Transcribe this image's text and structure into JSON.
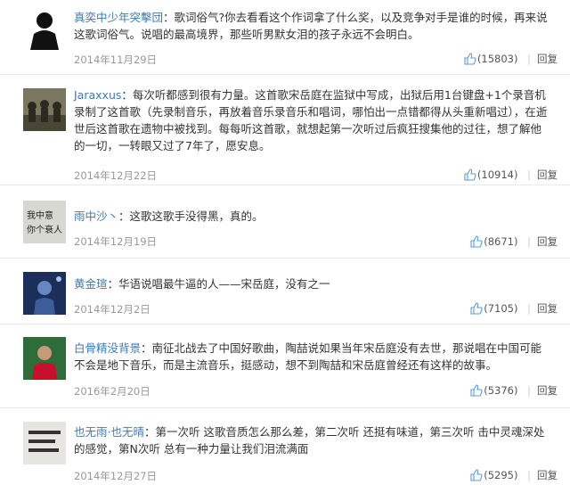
{
  "comments": [
    {
      "username": "真奕中少年突擊団",
      "text": "歌词俗气?你去看看这个作词拿了什么奖，以及竞争对手是谁的时候，再来说这歌词俗气。说唱的最高境界，那些听男默女泪的孩子永远不会明白。",
      "date": "2014年11月29日",
      "likes": "(15803)",
      "reply": "回复"
    },
    {
      "username": "Jaraxxus",
      "text": "每次听都感到很有力量。这首歌宋岳庭在监狱中写成，出狱后用1台键盘+1个录音机录制了这首歌（先录制音乐，再放着音乐录音乐和唱词，哪怕出一点错都得从头重新唱过），在逝世后这首歌在遗物中被找到。每每听这首歌，就想起第一次听过后疯狂搜集他的过往，想了解他的一切，一转眼又过了7年了，愿安息。",
      "date": "2014年12月22日",
      "likes": "(10914)",
      "reply": "回复"
    },
    {
      "username": "雨中沙丶",
      "text": "这歌这歌手没得黑，真的。",
      "date": "2014年12月19日",
      "likes": "(8671)",
      "reply": "回复"
    },
    {
      "username": "黄金瑄",
      "text": "华语说唱最牛逼的人——宋岳庭，没有之一",
      "date": "2014年12月2日",
      "likes": "(7105)",
      "reply": "回复"
    },
    {
      "username": "白骨精没背景",
      "text": "南征北战去了中国好歌曲，陶喆说如果当年宋岳庭没有去世，那说唱在中国可能不会是地下音乐，而是主流音乐，挺感动，想不到陶喆和宋岳庭曾经还有这样的故事。",
      "date": "2016年2月20日",
      "likes": "(5376)",
      "reply": "回复"
    },
    {
      "username": "也无雨·也无晴",
      "text": "第一次听 这歌音质怎么那么差，第二次听 还挺有味道，第三次听 击中灵魂深处的感觉，第N次听 总有一种力量让我们泪流满面",
      "date": "2014年12月27日",
      "likes": "(5295)",
      "reply": "回复"
    }
  ],
  "avatar_text": [
    "我中意",
    "你个衰人"
  ],
  "colors": {
    "username": "#3d7ab8",
    "date": "#999999",
    "text": "#333333",
    "divider": "#e9e9e9"
  }
}
